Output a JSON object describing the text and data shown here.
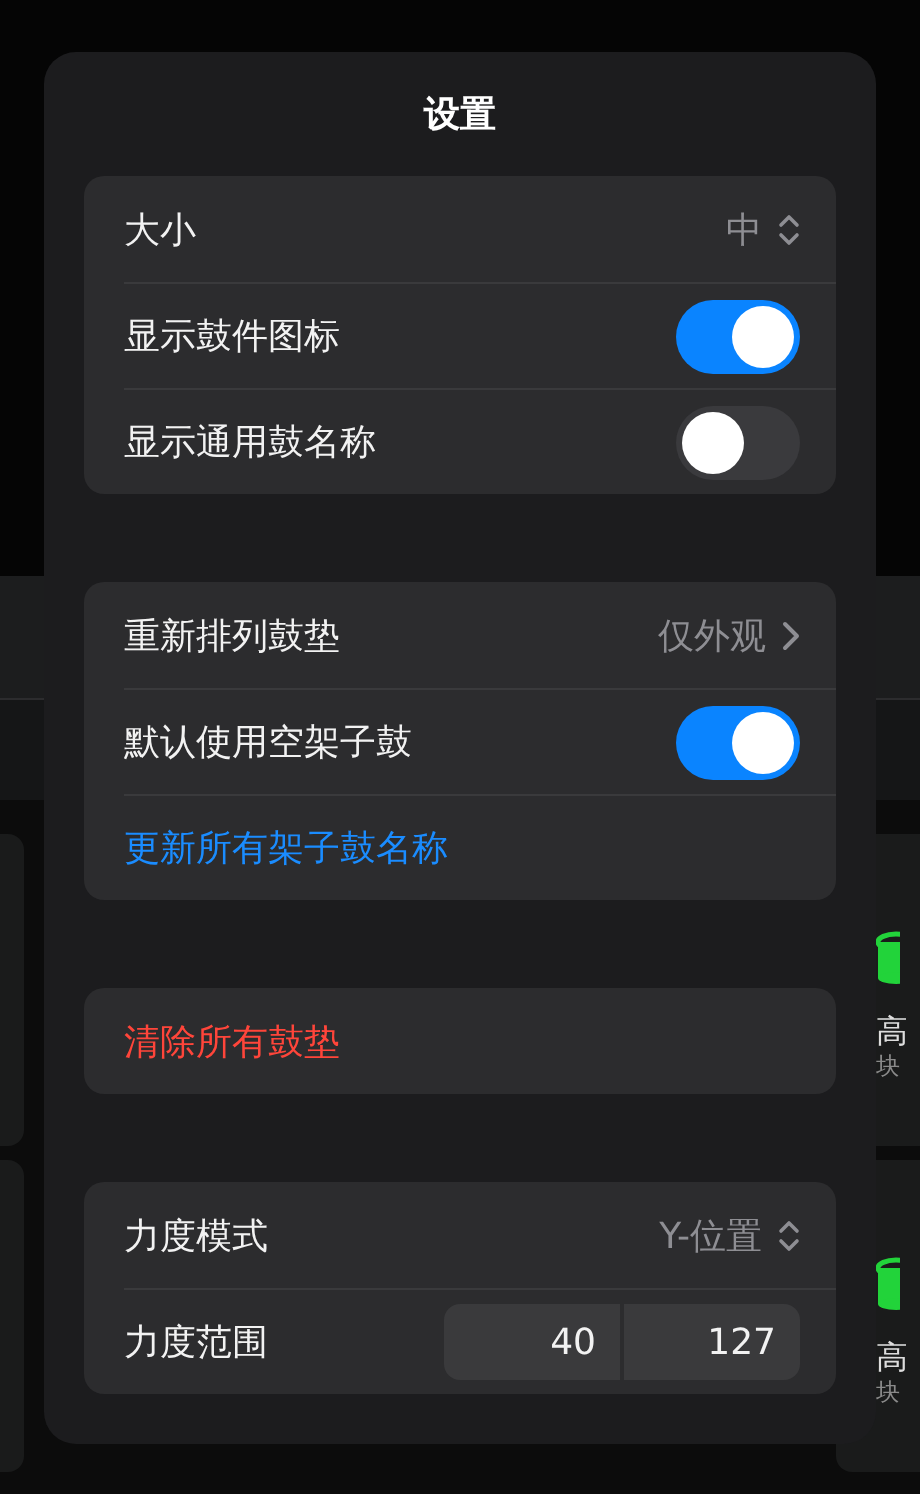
{
  "title": "设置",
  "groups": [
    {
      "rows": [
        {
          "kind": "picker",
          "label": "大小",
          "value": "中"
        },
        {
          "kind": "toggle",
          "label": "显示鼓件图标",
          "on": true
        },
        {
          "kind": "toggle",
          "label": "显示通用鼓名称",
          "on": false
        }
      ]
    },
    {
      "rows": [
        {
          "kind": "link",
          "label": "重新排列鼓垫",
          "value": "仅外观"
        },
        {
          "kind": "toggle",
          "label": "默认使用空架子鼓",
          "on": true
        },
        {
          "kind": "action",
          "label": "更新所有架子鼓名称",
          "color": "#1a8cff"
        }
      ]
    },
    {
      "rows": [
        {
          "kind": "action",
          "label": "清除所有鼓垫",
          "color": "#ff453a"
        }
      ]
    },
    {
      "rows": [
        {
          "kind": "picker",
          "label": "力度模式",
          "value": "Y-位置"
        },
        {
          "kind": "range",
          "label": "力度范围",
          "low": "40",
          "high": "127"
        }
      ]
    }
  ],
  "background_pads": [
    {
      "name": "高",
      "sub": "块"
    },
    {
      "name": "高",
      "sub": "块"
    }
  ]
}
